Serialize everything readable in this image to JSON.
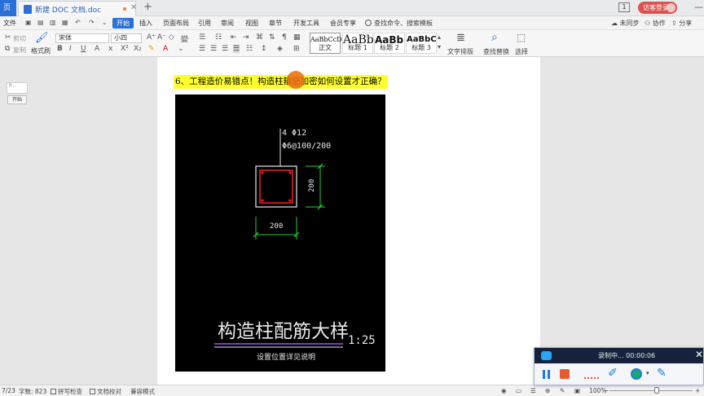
{
  "titlebar": {
    "home_label": "页",
    "doc_tab_title": "新建 DOC 文档.doc",
    "new_tab": "+",
    "badge": "1",
    "guest_login": "访客登录",
    "minimize": "—"
  },
  "menubar": {
    "file": "文件",
    "items": [
      "开始",
      "插入",
      "页面布局",
      "引用",
      "审阅",
      "视图",
      "章节",
      "开发工具",
      "会员专享"
    ],
    "search_placeholder": "查找命令、搜索模板",
    "sync": "未同步",
    "collaborate": "协作",
    "share": "分享"
  },
  "ribbon": {
    "cut": "剪切",
    "copy": "复制",
    "format_painter": "格式刷",
    "font_name": "宋体",
    "font_size": "小四",
    "styles": [
      {
        "sample": "AaBbCcDd",
        "name": "正文"
      },
      {
        "sample": "AaBb",
        "name": "标题 1"
      },
      {
        "sample": "AaBb(",
        "name": "标题 2"
      },
      {
        "sample": "AaBbC(",
        "name": "标题 3"
      }
    ],
    "text_layout": "文字排版",
    "find_replace": "查找替换",
    "select": "选择"
  },
  "navigator": {
    "thumb_text": "P...",
    "button": "开始"
  },
  "document": {
    "heading": "6、工程造价易错点！构造柱箍筋加密如何设置才正确？"
  },
  "drawing": {
    "rebar_main": "4 Φ12",
    "rebar_stirrup": "Φ6@100/200",
    "dim_height": "200",
    "dim_width": "200",
    "title": "构造柱配筋大样",
    "scale": "1:25",
    "note": "设置位置详见说明"
  },
  "statusbar": {
    "page": "7/23",
    "word_count": "字数: 823",
    "spell_check": "拼写检查",
    "doc_proof": "文档校对",
    "compat_mode": "兼容模式",
    "zoom": "100%",
    "zoom_minus": "−",
    "zoom_plus": "+"
  },
  "recorder": {
    "status": "录制中... 00:00:06",
    "close": "✕"
  },
  "colors": {
    "accent_blue": "#2b6fd9",
    "highlight_yellow": "#ffff2d",
    "cad_white": "#e8e8e8",
    "cad_green": "#29d13a",
    "cad_red": "#e02020",
    "cad_purple": "#7a3fb0",
    "cursor_orange": "#eb6e14",
    "recorder_header": "#16223b",
    "stop_red": "#ea5a2e"
  }
}
